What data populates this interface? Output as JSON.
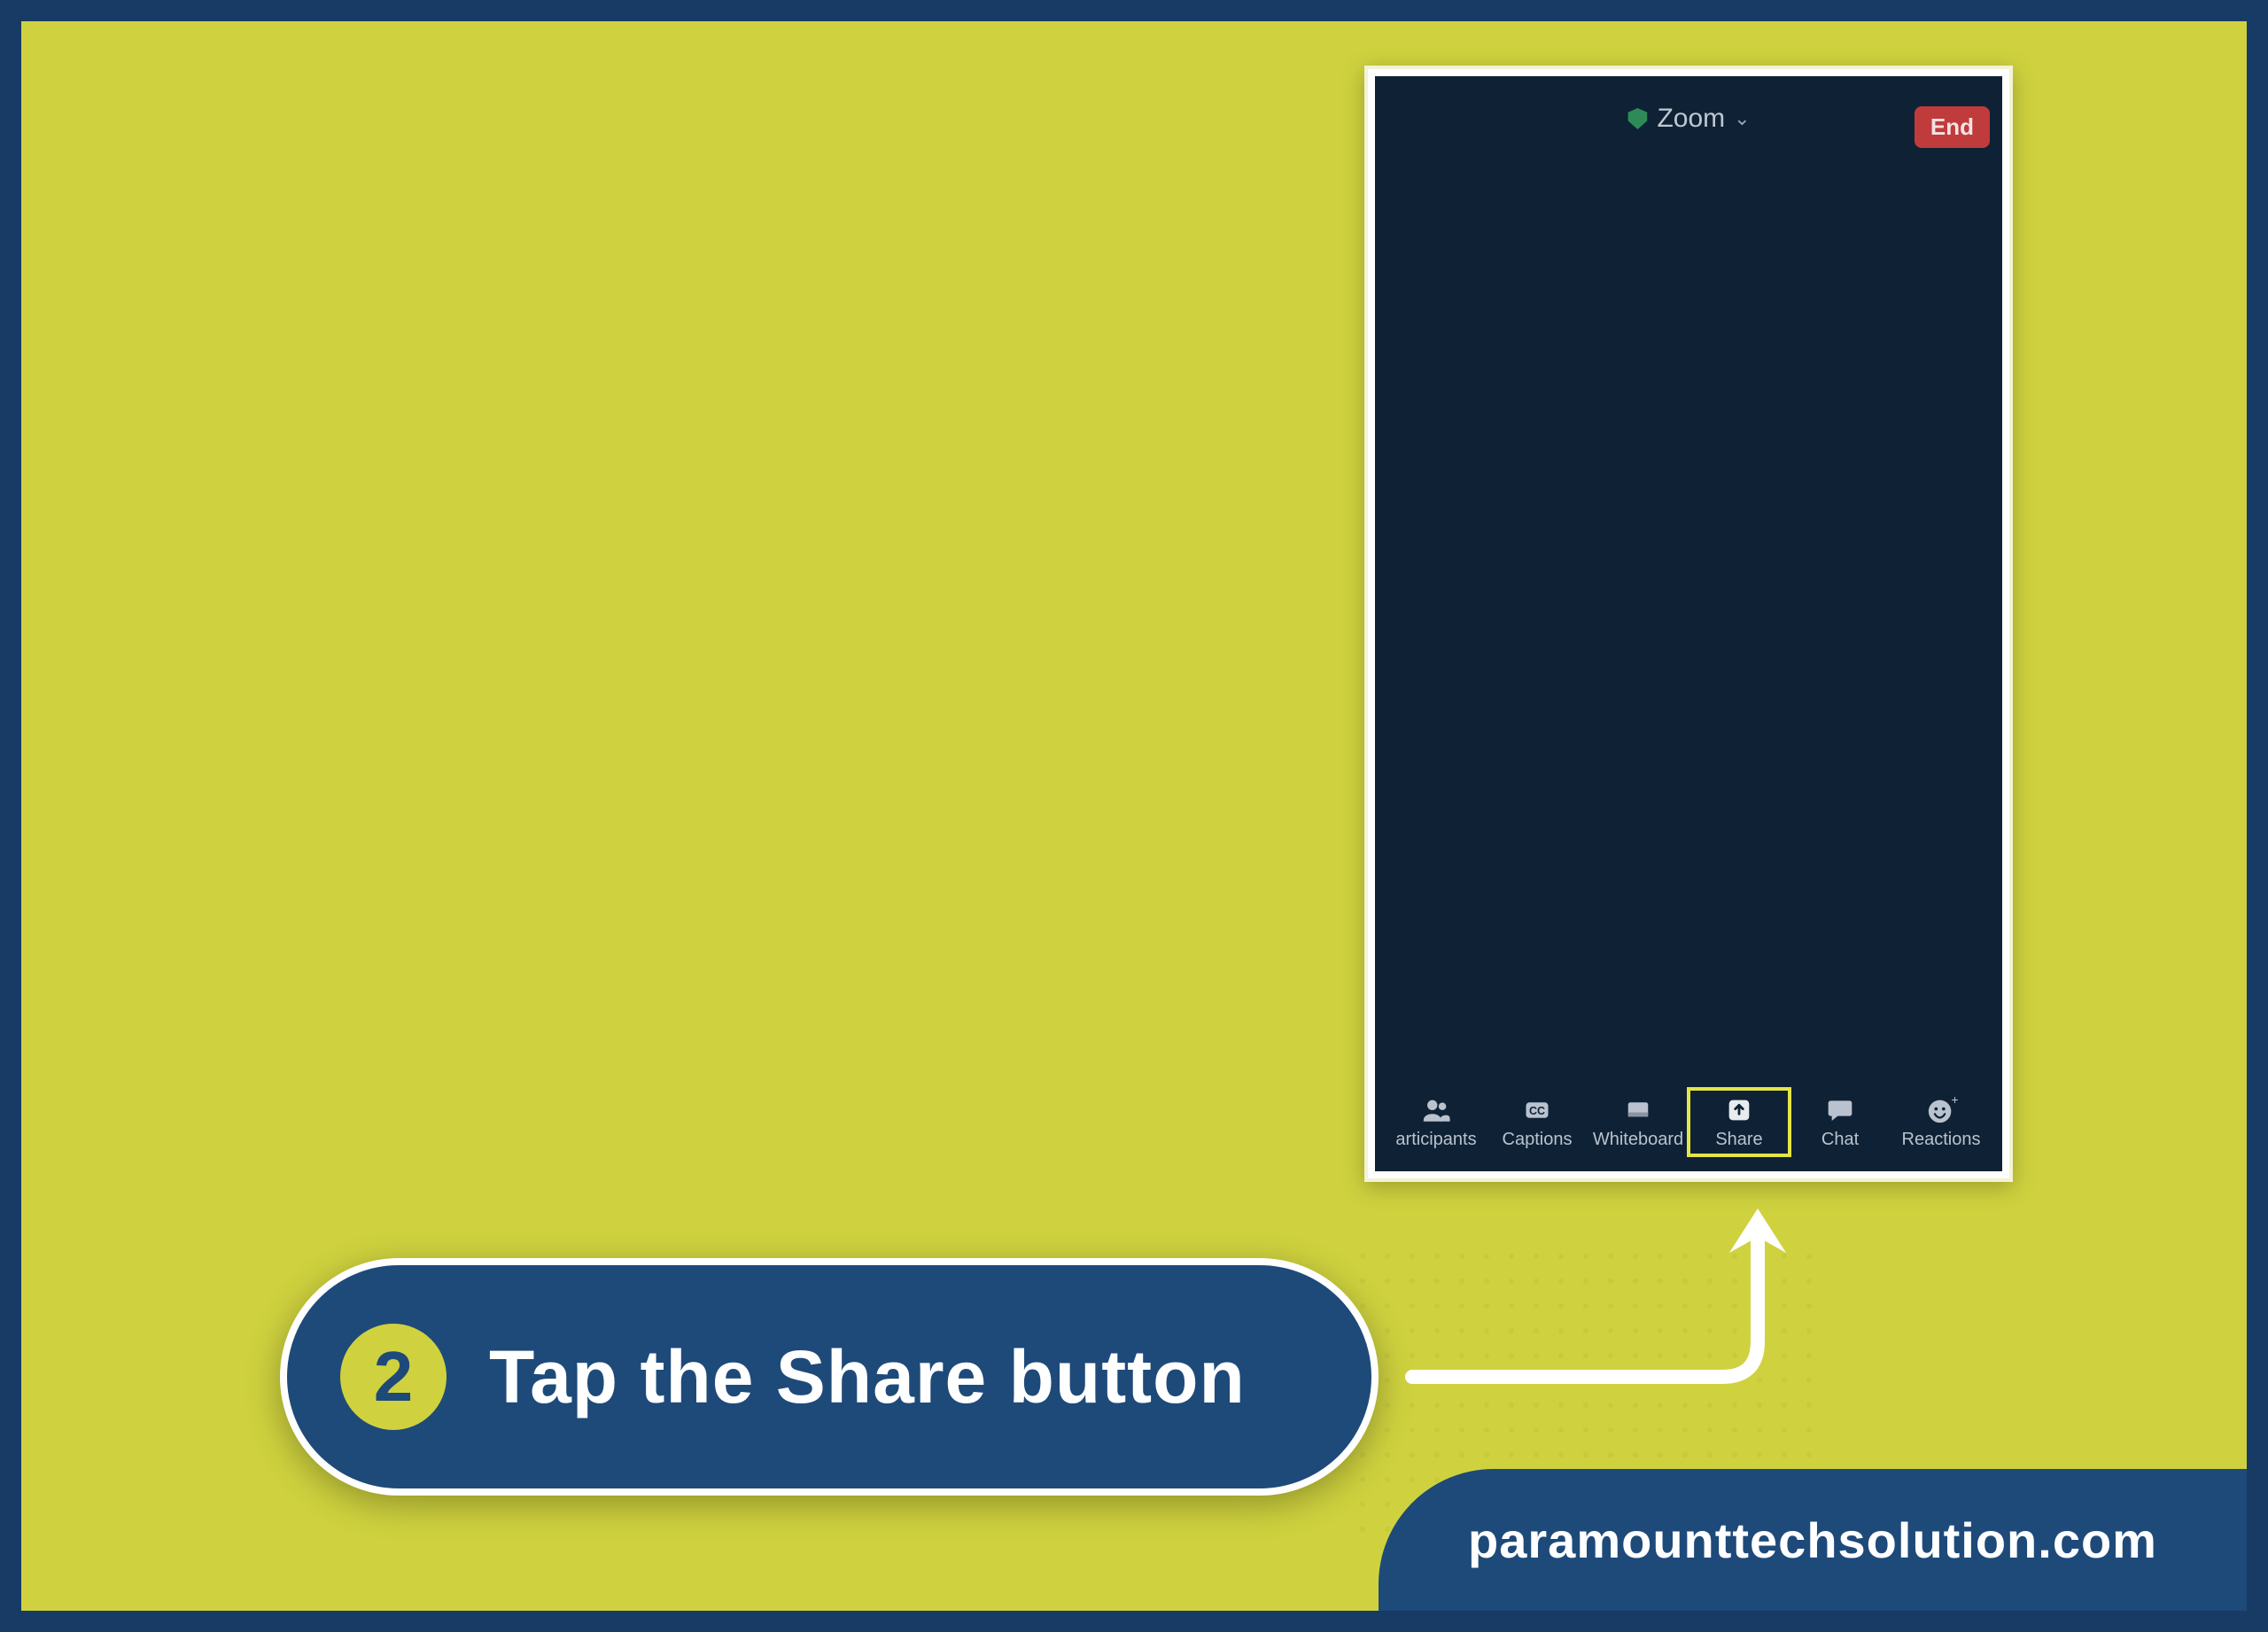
{
  "colors": {
    "frame": "#173b65",
    "canvas": "#cfd23e",
    "pill_bg": "#1e4a7a",
    "highlight": "#e4e546",
    "end_btn": "#c03b3b"
  },
  "phone": {
    "app_label": "Zoom",
    "end_label": "End",
    "toolbar": [
      {
        "key": "participants",
        "label": "articipants"
      },
      {
        "key": "captions",
        "label": "Captions"
      },
      {
        "key": "whiteboard",
        "label": "Whiteboard"
      },
      {
        "key": "share",
        "label": "Share",
        "highlighted": true
      },
      {
        "key": "chat",
        "label": "Chat"
      },
      {
        "key": "reactions",
        "label": "Reactions"
      }
    ]
  },
  "instruction": {
    "step_number": "2",
    "text": "Tap the Share button"
  },
  "footer": {
    "site": "paramounttechsolution.com"
  }
}
